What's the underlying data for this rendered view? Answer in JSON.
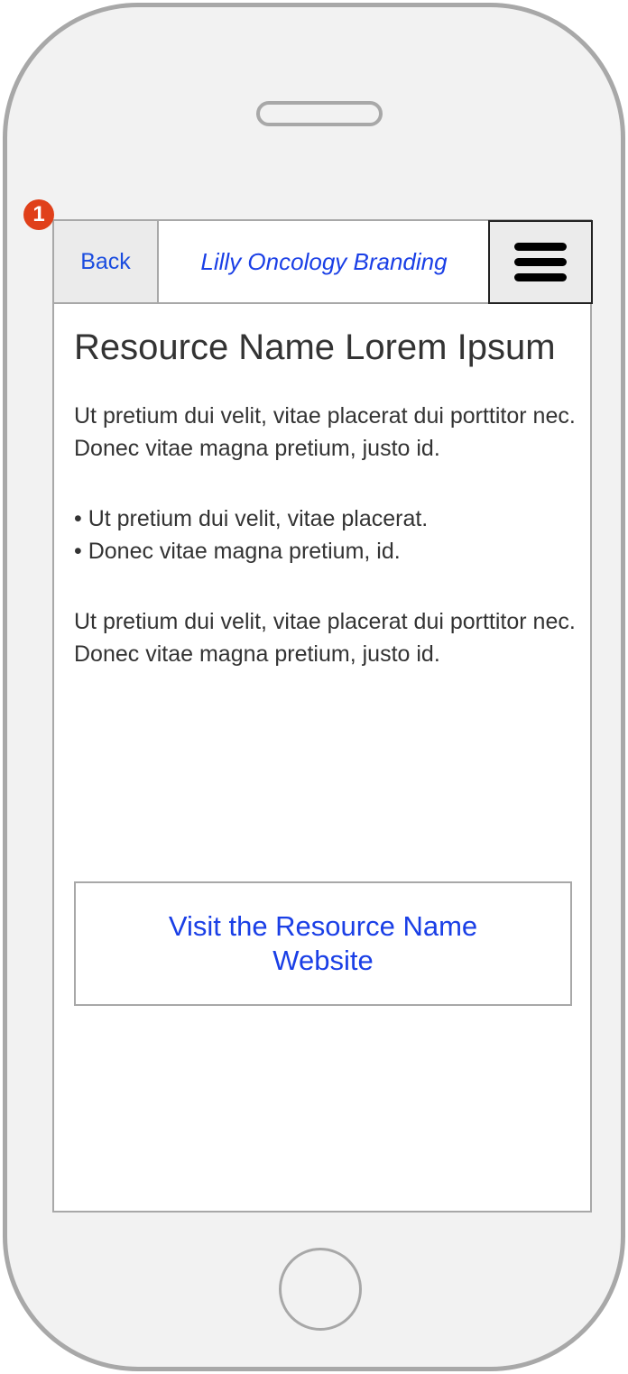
{
  "header": {
    "back_label": "Back",
    "brand_title": "Lilly Oncology Branding",
    "menu_icon": "hamburger-menu-icon"
  },
  "annotation": {
    "badge_number": "1",
    "badge_color": "#e0401a"
  },
  "content": {
    "title": "Resource Name Lorem Ipsum",
    "paragraph_1": "Ut pretium dui velit, vitae placerat dui porttitor nec. Donec vitae magna pretium, justo id.",
    "bullets": [
      "Ut pretium dui velit, vitae placerat.",
      "Donec vitae magna pretium, id."
    ],
    "paragraph_2": "Ut pretium dui velit, vitae placerat dui porttitor nec. Donec vitae magna pretium, justo id.",
    "cta_label": "Visit the Resource Name Website"
  },
  "colors": {
    "link_blue": "#1a3fe6",
    "frame_gray": "#a8a8a8",
    "body_text": "#333333"
  }
}
